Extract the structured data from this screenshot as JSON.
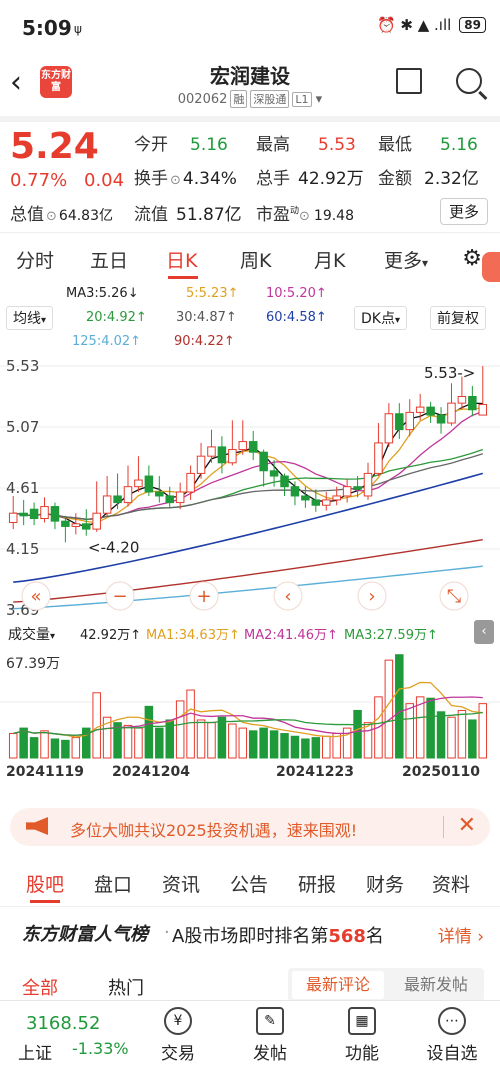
{
  "status": {
    "time": "5:09",
    "sim": "ψ",
    "icons": "⏰ ✱ ▲ .ıll",
    "battery": "89"
  },
  "header": {
    "logo": "东方财富",
    "name": "宏润建设",
    "code": "002062",
    "tags": [
      "融",
      "深股通",
      "L1"
    ]
  },
  "quote": {
    "price": "5.24",
    "pct": "0.77%",
    "chg": "0.04",
    "open_label": "今开",
    "open": "5.16",
    "high_label": "最高",
    "high": "5.53",
    "low_label": "最低",
    "low": "5.16",
    "turnover_label": "换手",
    "turnover": "4.34%",
    "volume_label": "总手",
    "volume": "42.92万",
    "amount_label": "金额",
    "amount": "2.32亿",
    "mktcap_label": "总值",
    "mktcap": "64.83亿",
    "float_label": "流值",
    "float": "51.87亿",
    "pe_label": "市盈",
    "pe_sup": "动",
    "pe": "19.48",
    "more": "更多"
  },
  "chart_tabs": [
    "分时",
    "五日",
    "日K",
    "周K",
    "月K",
    "更多"
  ],
  "ma": {
    "ma3": "MA3:5.26↓",
    "ma5": "5:5.23↑",
    "ma10": "10:5.20↑",
    "ma20": "20:4.92↑",
    "ma30": "30:4.87↑",
    "ma60": "60:4.58↑",
    "ma125": "125:4.02↑",
    "ma90": "90:4.22↑",
    "junxian": "均线",
    "dk": "DK点",
    "fq": "前复权"
  },
  "kline": {
    "y_high": "5.53",
    "y_mid1": "5.07",
    "y_mid2": "4.61",
    "y_low": "4.15",
    "y_min": "3.69",
    "max_note": "5.53->",
    "min_note": "<-4.20"
  },
  "volume": {
    "label": "成交量",
    "v": "42.92万↑",
    "ma1": "MA1:34.63万↑",
    "ma2": "MA2:41.46万↑",
    "ma3": "MA3:27.59万↑",
    "ymax": "67.39万"
  },
  "dates": [
    "20241119",
    "20241204",
    "20241223",
    "20250110"
  ],
  "banner": "多位大咖共议2025投资机遇，速来围观!",
  "bottom_tabs": [
    "股吧",
    "盘口",
    "资讯",
    "公告",
    "研报",
    "财务",
    "资料"
  ],
  "rank": {
    "brand": "东方财富人气榜",
    "text": "A股市场即时排名第",
    "num": "568",
    "unit": "名",
    "detail": "详情"
  },
  "sub_tabs": {
    "all": "全部",
    "hot": "热门",
    "latest_comment": "最新评论",
    "latest_post": "最新发帖"
  },
  "footer": {
    "index": "3168.52",
    "index_name": "上证",
    "index_pct": "-1.33%",
    "items": [
      "交易",
      "发帖",
      "功能",
      "设自选"
    ]
  },
  "colors": {
    "up": "#e63c2e",
    "down": "#1f9a3a",
    "accent": "#e05a2a"
  },
  "chart_data": {
    "type": "candlestick",
    "ylim": [
      3.69,
      5.53
    ],
    "candles": [
      [
        4.35,
        4.42,
        4.55,
        4.3
      ],
      [
        4.42,
        4.4,
        4.52,
        4.33
      ],
      [
        4.45,
        4.38,
        4.5,
        4.33
      ],
      [
        4.38,
        4.47,
        4.54,
        4.35
      ],
      [
        4.47,
        4.36,
        4.5,
        4.3
      ],
      [
        4.36,
        4.32,
        4.4,
        4.2
      ],
      [
        4.32,
        4.34,
        4.42,
        4.26
      ],
      [
        4.34,
        4.3,
        4.45,
        4.25
      ],
      [
        4.3,
        4.42,
        4.66,
        4.28
      ],
      [
        4.42,
        4.55,
        4.7,
        4.4
      ],
      [
        4.55,
        4.5,
        4.72,
        4.45
      ],
      [
        4.5,
        4.62,
        4.78,
        4.47
      ],
      [
        4.62,
        4.67,
        4.85,
        4.58
      ],
      [
        4.7,
        4.58,
        4.78,
        4.55
      ],
      [
        4.58,
        4.55,
        4.7,
        4.5
      ],
      [
        4.55,
        4.5,
        4.62,
        4.46
      ],
      [
        4.5,
        4.58,
        4.65,
        4.45
      ],
      [
        4.58,
        4.72,
        4.78,
        4.52
      ],
      [
        4.72,
        4.85,
        4.95,
        4.68
      ],
      [
        4.85,
        4.92,
        5.05,
        4.8
      ],
      [
        4.92,
        4.8,
        5.0,
        4.72
      ],
      [
        4.8,
        4.9,
        5.12,
        4.78
      ],
      [
        4.9,
        4.96,
        5.12,
        4.86
      ],
      [
        4.96,
        4.88,
        5.04,
        4.82
      ],
      [
        4.88,
        4.74,
        4.9,
        4.62
      ],
      [
        4.74,
        4.7,
        4.82,
        4.62
      ],
      [
        4.7,
        4.62,
        4.72,
        4.55
      ],
      [
        4.62,
        4.55,
        4.66,
        4.48
      ],
      [
        4.55,
        4.52,
        4.62,
        4.46
      ],
      [
        4.52,
        4.48,
        4.6,
        4.43
      ],
      [
        4.48,
        4.52,
        4.58,
        4.44
      ],
      [
        4.52,
        4.55,
        4.62,
        4.48
      ],
      [
        4.55,
        4.62,
        4.68,
        4.5
      ],
      [
        4.62,
        4.6,
        4.7,
        4.54
      ],
      [
        4.55,
        4.72,
        4.8,
        4.52
      ],
      [
        4.72,
        4.95,
        5.1,
        4.7
      ],
      [
        4.95,
        5.17,
        5.25,
        4.92
      ],
      [
        5.17,
        5.05,
        5.25,
        4.98
      ],
      [
        5.05,
        5.18,
        5.28,
        5.0
      ],
      [
        5.18,
        5.22,
        5.32,
        5.12
      ],
      [
        5.22,
        5.16,
        5.26,
        5.1
      ],
      [
        5.16,
        5.1,
        5.22,
        5.02
      ],
      [
        5.1,
        5.25,
        5.4,
        5.08
      ],
      [
        5.25,
        5.3,
        5.45,
        5.2
      ],
      [
        5.3,
        5.2,
        5.38,
        5.15
      ],
      [
        5.16,
        5.24,
        5.53,
        5.16
      ]
    ],
    "volumes": [
      18,
      22,
      15,
      20,
      14,
      13,
      15,
      22,
      48,
      30,
      26,
      24,
      22,
      38,
      22,
      28,
      42,
      50,
      28,
      26,
      30,
      25,
      22,
      20,
      22,
      20,
      18,
      16,
      14,
      15,
      16,
      18,
      22,
      35,
      26,
      45,
      72,
      76,
      40,
      45,
      44,
      34,
      30,
      35,
      28,
      40
    ]
  }
}
